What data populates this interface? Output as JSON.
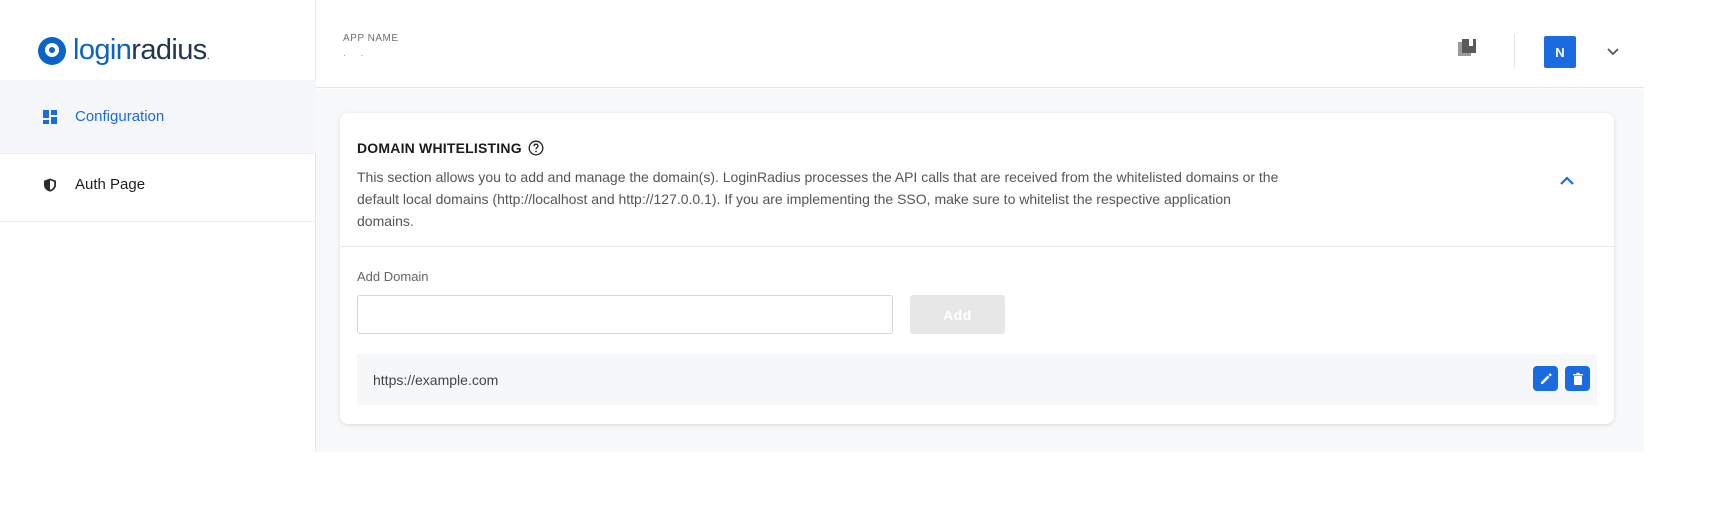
{
  "top_fragment": "app",
  "logo": {
    "text_a": "login",
    "text_b": "radius",
    "dot": "."
  },
  "sidebar": {
    "items": [
      {
        "label": "Configuration",
        "icon": "dashboard-icon",
        "active": true
      },
      {
        "label": "Auth Page",
        "icon": "shield-icon",
        "active": false
      }
    ]
  },
  "header": {
    "app_name_label": "APP NAME",
    "app_name_value": ". .",
    "avatar_letter": "N",
    "docs_icon": "library-icon",
    "chevron_icon": "chevron-down-icon"
  },
  "card": {
    "title": "DOMAIN WHITELISTING",
    "description": "This section allows you to add and manage the domain(s). LoginRadius processes the API calls that are received from the whitelisted domains or the default local domains (http://localhost and http://127.0.0.1). If you are implementing the SSO, make sure to whitelist the respective application domains.",
    "add_domain_label": "Add Domain",
    "add_domain_value": "",
    "add_button_label": "Add",
    "domains": [
      {
        "url": "https://example.com"
      }
    ]
  },
  "colors": {
    "accent": "#1b6be0",
    "brand_blue": "#0a63c9",
    "brand_navy": "#24364f",
    "disabled_button": "#e7e7e7"
  }
}
